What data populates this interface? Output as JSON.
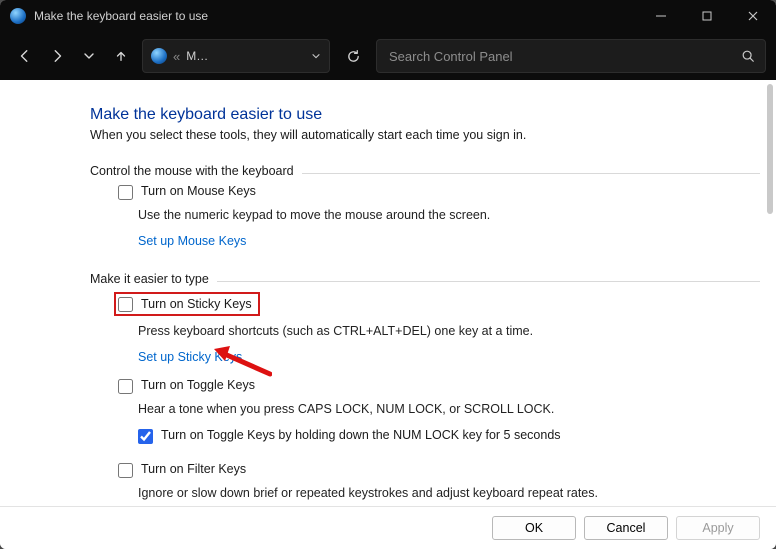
{
  "window": {
    "title": "Make the keyboard easier to use"
  },
  "toolbar": {
    "crumb_text": "M…",
    "crumb_sep": "«",
    "search_placeholder": "Search Control Panel"
  },
  "page": {
    "heading": "Make the keyboard easier to use",
    "sub": "When you select these tools, they will automatically start each time you sign in."
  },
  "mouse_group": {
    "label": "Control the mouse with the keyboard",
    "checkbox": "Turn on Mouse Keys",
    "desc": "Use the numeric keypad to move the mouse around the screen.",
    "link": "Set up Mouse Keys"
  },
  "type_group": {
    "label": "Make it easier to type",
    "sticky_checkbox": "Turn on Sticky Keys",
    "sticky_desc": "Press keyboard shortcuts (such as CTRL+ALT+DEL) one key at a time.",
    "sticky_link": "Set up Sticky Keys",
    "toggle_checkbox": "Turn on Toggle Keys",
    "toggle_desc": "Hear a tone when you press CAPS LOCK, NUM LOCK, or SCROLL LOCK.",
    "toggle_hold": "Turn on Toggle Keys by holding down the NUM LOCK key for 5 seconds",
    "filter_checkbox": "Turn on Filter Keys",
    "filter_desc": "Ignore or slow down brief or repeated keystrokes and adjust keyboard repeat rates."
  },
  "footer": {
    "ok": "OK",
    "cancel": "Cancel",
    "apply": "Apply"
  }
}
